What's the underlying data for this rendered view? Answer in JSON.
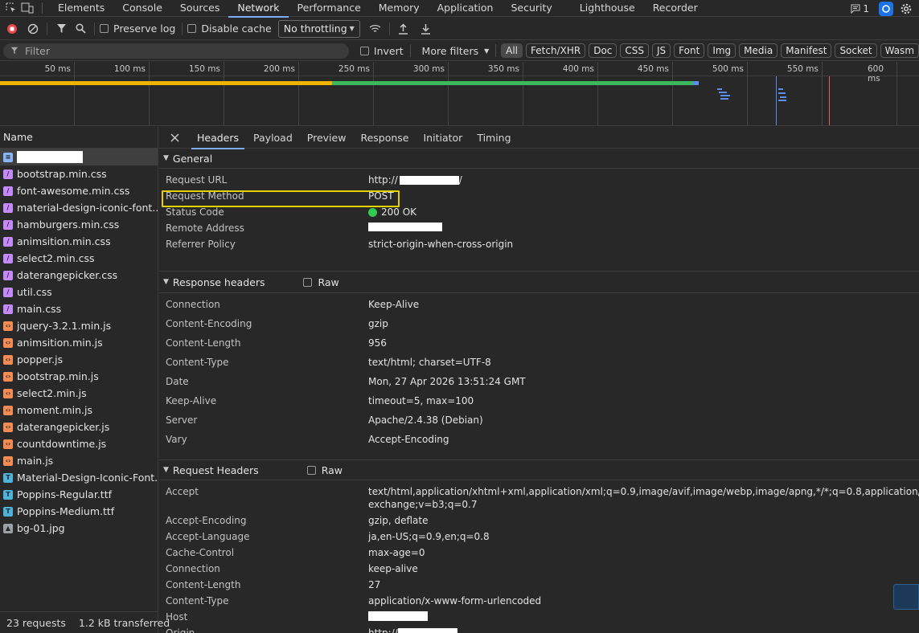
{
  "topbar": {
    "tabs": [
      "Elements",
      "Console",
      "Sources",
      "Network",
      "Performance",
      "Memory",
      "Application",
      "Security",
      "Lighthouse",
      "Recorder"
    ],
    "active_tab": "Network",
    "issues_count": "1"
  },
  "toolbar": {
    "preserve_log": "Preserve log",
    "disable_cache": "Disable cache",
    "throttling": "No throttling"
  },
  "filterbar": {
    "filter_placeholder": "Filter",
    "invert": "Invert",
    "more_filters": "More filters",
    "types": [
      "All",
      "Fetch/XHR",
      "Doc",
      "CSS",
      "JS",
      "Font",
      "Img",
      "Media",
      "Manifest",
      "Socket",
      "Wasm"
    ]
  },
  "timeline": {
    "ticks": [
      "50 ms",
      "100 ms",
      "150 ms",
      "200 ms",
      "250 ms",
      "300 ms",
      "350 ms",
      "400 ms",
      "450 ms",
      "500 ms",
      "550 ms",
      "600 ms"
    ],
    "colors": {
      "waiting": "#f0b400",
      "download": "#3db85c",
      "marker_blue": "#5b8def",
      "marker_red": "#e06060"
    }
  },
  "requests": {
    "header": "Name",
    "items": [
      {
        "name": "",
        "type": "doc",
        "redacted": true
      },
      {
        "name": "bootstrap.min.css",
        "type": "css"
      },
      {
        "name": "font-awesome.min.css",
        "type": "css"
      },
      {
        "name": "material-design-iconic-font.…",
        "type": "css"
      },
      {
        "name": "hamburgers.min.css",
        "type": "css"
      },
      {
        "name": "animsition.min.css",
        "type": "css"
      },
      {
        "name": "select2.min.css",
        "type": "css"
      },
      {
        "name": "daterangepicker.css",
        "type": "css"
      },
      {
        "name": "util.css",
        "type": "css"
      },
      {
        "name": "main.css",
        "type": "css"
      },
      {
        "name": "jquery-3.2.1.min.js",
        "type": "js"
      },
      {
        "name": "animsition.min.js",
        "type": "js"
      },
      {
        "name": "popper.js",
        "type": "js"
      },
      {
        "name": "bootstrap.min.js",
        "type": "js"
      },
      {
        "name": "select2.min.js",
        "type": "js"
      },
      {
        "name": "moment.min.js",
        "type": "js"
      },
      {
        "name": "daterangepicker.js",
        "type": "js"
      },
      {
        "name": "countdowntime.js",
        "type": "js"
      },
      {
        "name": "main.js",
        "type": "js"
      },
      {
        "name": "Material-Design-Iconic-Font.…",
        "type": "font"
      },
      {
        "name": "Poppins-Regular.ttf",
        "type": "font"
      },
      {
        "name": "Poppins-Medium.ttf",
        "type": "font"
      },
      {
        "name": "bg-01.jpg",
        "type": "img"
      }
    ],
    "footer_requests": "23 requests",
    "footer_transferred": "1.2 kB transferred"
  },
  "detail": {
    "tabs": [
      "Headers",
      "Payload",
      "Preview",
      "Response",
      "Initiator",
      "Timing"
    ],
    "active_tab": "Headers",
    "general": {
      "title": "General",
      "rows": [
        {
          "key": "Request URL",
          "value": "http://",
          "suffix": "/",
          "redacted": true
        },
        {
          "key": "Request Method",
          "value": "POST",
          "highlight": true
        },
        {
          "key": "Status Code",
          "value": "200 OK",
          "status_dot": true
        },
        {
          "key": "Remote Address",
          "value": "",
          "redacted": true
        },
        {
          "key": "Referrer Policy",
          "value": "strict-origin-when-cross-origin"
        }
      ]
    },
    "response_headers": {
      "title": "Response headers",
      "raw_label": "Raw",
      "rows": [
        {
          "key": "Connection",
          "value": "Keep-Alive"
        },
        {
          "key": "Content-Encoding",
          "value": "gzip"
        },
        {
          "key": "Content-Length",
          "value": "956"
        },
        {
          "key": "Content-Type",
          "value": "text/html; charset=UTF-8"
        },
        {
          "key": "Date",
          "value": "Mon, 27 Apr 2026 13:51:24 GMT"
        },
        {
          "key": "Keep-Alive",
          "value": "timeout=5, max=100"
        },
        {
          "key": "Server",
          "value": "Apache/2.4.38 (Debian)"
        },
        {
          "key": "Vary",
          "value": "Accept-Encoding"
        }
      ]
    },
    "request_headers": {
      "title": "Request Headers",
      "raw_label": "Raw",
      "rows": [
        {
          "key": "Accept",
          "value": "text/html,application/xhtml+xml,application/xml;q=0.9,image/avif,image/webp,image/apng,*/*;q=0.8,application/signed-",
          "value2": "exchange;v=b3;q=0.7"
        },
        {
          "key": "Accept-Encoding",
          "value": "gzip, deflate"
        },
        {
          "key": "Accept-Language",
          "value": "ja,en-US;q=0.9,en;q=0.8"
        },
        {
          "key": "Cache-Control",
          "value": "max-age=0"
        },
        {
          "key": "Connection",
          "value": "keep-alive"
        },
        {
          "key": "Content-Length",
          "value": "27"
        },
        {
          "key": "Content-Type",
          "value": "application/x-www-form-urlencoded"
        },
        {
          "key": "Host",
          "value": "",
          "redacted": true
        },
        {
          "key": "Origin",
          "value": "http://",
          "redacted": true
        }
      ]
    }
  }
}
